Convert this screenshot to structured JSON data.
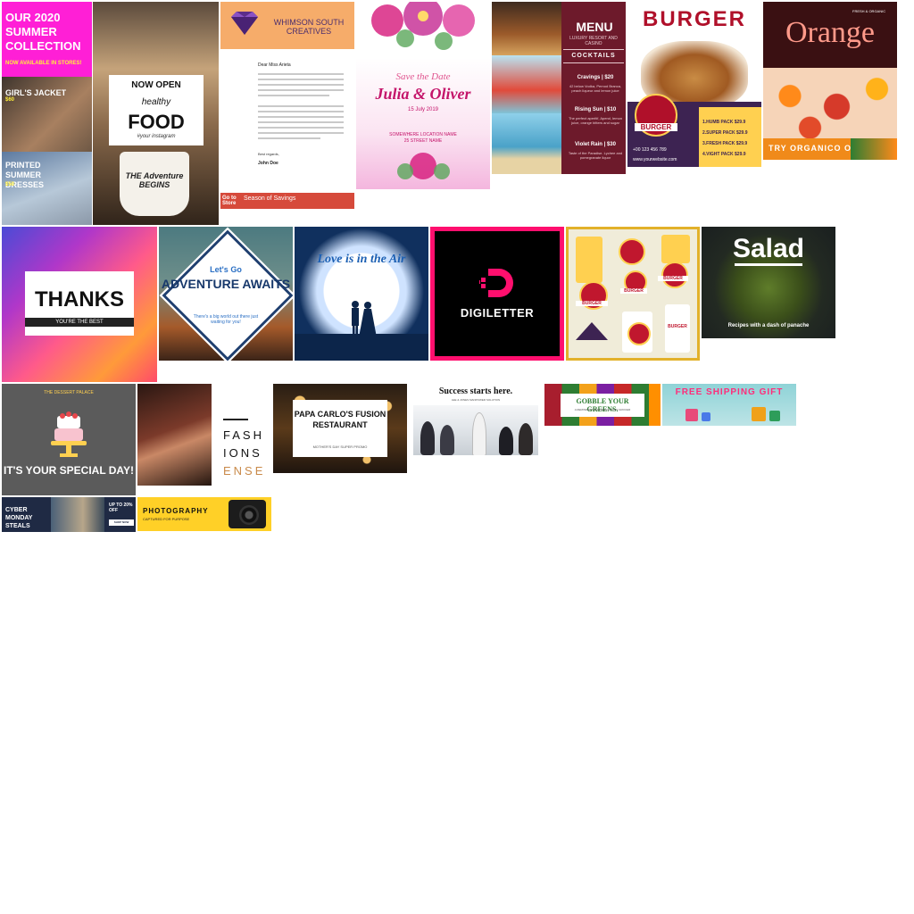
{
  "templates": {
    "t1": {
      "headline": "OUR 2020 SUMMER COLLECTION",
      "subline": "NOW AVAILABLE IN STORES!",
      "item1_label": "GIRL'S JACKET",
      "item1_price": "$60",
      "item2_label": "PRINTED SUMMER DRESSES",
      "item2_price": "$50",
      "colors": {
        "accent": "#ff1fd6",
        "price": "#ffef3a"
      }
    },
    "t2": {
      "line1": "NOW OPEN",
      "line2": "healthy",
      "line3": "FOOD",
      "line4": "#your instagram",
      "mug_text": "THE Adventure BEGINS"
    },
    "t3": {
      "company": "WHIMSON SOUTH CREATIVES",
      "salutation": "Dear Miss Arieta",
      "closing": "Best regards,",
      "signature": "John Doe",
      "footer_left": "Go to Store",
      "footer_right": "Season of Savings"
    },
    "t4": {
      "line1": "Save the Date",
      "names": "Julia & Oliver",
      "date": "15 July 2019",
      "location1": "SOMEWHERE LOCATION NAME",
      "location2": "25 STREET NAME"
    },
    "t5": {
      "title": "MENU",
      "subtitle": "LUXURY RESORT AND CASINO",
      "section": "COCKTAILS",
      "items": [
        {
          "name": "Cravings | $20",
          "desc": "42 below Vodka, Pernod Branca, peach liqueur and lemon juice"
        },
        {
          "name": "Rising Sun | $10",
          "desc": "The perfect aperitif, Aperol, lemon juice, orange bitters and sugar"
        },
        {
          "name": "Violet Rain | $30",
          "desc": "Taste of the Paradise. Lychee and pomegranate liquor"
        }
      ]
    },
    "t6": {
      "title": "BURGER",
      "logo_text": "BURGER",
      "rows": [
        "1.HUMB   PACK   $29.9",
        "2.SUPER  PACK   $29.9",
        "3.FRESH  PACK   $29.9",
        "4.VIGHT  PACK   $29.9"
      ],
      "phone": "+00 123 456 789",
      "website": "www.yourwebsite.com"
    },
    "t7": {
      "title": "Orange",
      "tag": "FRESH & ORGANIC",
      "cta": "TRY ORGANICO ORANGE"
    },
    "t8": {
      "title": "THANKS",
      "subtitle": "YOU'RE THE BEST"
    },
    "t9": {
      "line1": "Let's Go",
      "line2": "ADVENTURE AWAITS",
      "line3": "There's a big world out there just waiting for you!"
    },
    "t10": {
      "title": "Love is in the Air"
    },
    "t11": {
      "title": "DIGILETTER"
    },
    "t12": {
      "logo_label": "BURGER"
    },
    "t13": {
      "title": "Salad",
      "subtitle": "Recipes with a dash of panache"
    },
    "t14": {
      "top": "THE DESSERT PALACE",
      "title": "IT'S YOUR SPECIAL DAY!"
    },
    "t15": {
      "line1": "FASH",
      "line2": "IONS",
      "line3": "ENSE"
    },
    "t16": {
      "title": "PAPA CARLO'S FUSION RESTAURANT",
      "subtitle": "MOTHER'S DAY SUPER PROMO"
    },
    "t17": {
      "title": "Success starts here.",
      "subtitle": "LEE & JONES MANPOWER SOLUTION"
    },
    "t18": {
      "title": "GOBBLE YOUR GREENS.",
      "subtitle": "A REMINDER FROM BEECHTOWN GROCER"
    },
    "t19": {
      "title": "FREE SHIPPING GIFT"
    },
    "t20": {
      "title": "CYBER MONDAY STEALS",
      "offer": "UP TO 20% OFF",
      "cta": "SHOP NOW"
    },
    "t21": {
      "title": "PHOTOGRAPHY",
      "subtitle": "CAPTURED FOR PURPOSE"
    }
  }
}
